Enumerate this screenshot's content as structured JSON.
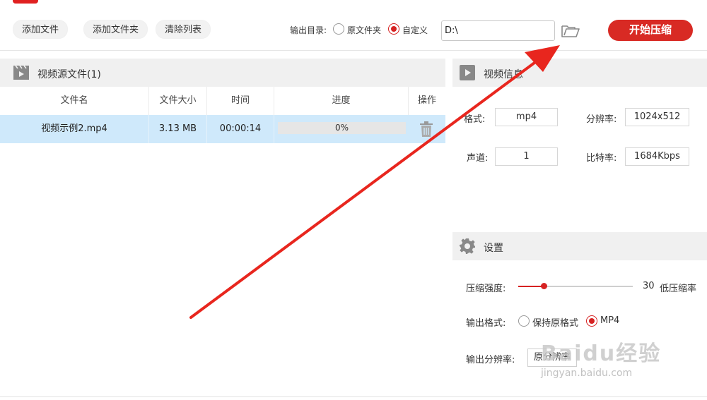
{
  "toolbar": {
    "add_file": "添加文件",
    "add_folder": "添加文件夹",
    "clear_list": "清除列表",
    "output_dir_label": "输出目录:",
    "radio_original": "原文件夹",
    "radio_custom": "自定义",
    "output_path": "D:\\",
    "start": "开始压缩"
  },
  "file_panel": {
    "title": "视频源文件(1)",
    "columns": [
      "文件名",
      "文件大小",
      "时间",
      "进度",
      "操作"
    ],
    "rows": [
      {
        "name": "视频示例2.mp4",
        "size": "3.13 MB",
        "duration": "00:00:14",
        "progress_text": "0%",
        "progress": 0
      }
    ]
  },
  "video_info": {
    "title": "视频信息",
    "format_label": "格式:",
    "format_value": "mp4",
    "resolution_label": "分辨率:",
    "resolution_value": "1024x512",
    "channel_label": "声道:",
    "channel_value": "1",
    "bitrate_label": "比特率:",
    "bitrate_value": "1684Kbps"
  },
  "settings": {
    "title": "设置",
    "strength_label": "压缩强度:",
    "strength_value": "30",
    "strength_percent": 22,
    "strength_desc": "低压缩率",
    "format_label": "输出格式:",
    "format_opt_keep": "保持原格式",
    "format_opt_mp4": "MP4",
    "res_label": "输出分辨率:",
    "res_value": "原分辨率"
  },
  "watermark": {
    "brand": "Baidu经验",
    "url": "jingyan.baidu.com"
  },
  "colors": {
    "accent": "#d82a24",
    "row_selected": "#cfe9fb",
    "panel_header": "#f0f0f0"
  },
  "icons": [
    "video-file-icon",
    "folder-open-icon",
    "trash-icon",
    "play-icon",
    "gear-icon"
  ]
}
